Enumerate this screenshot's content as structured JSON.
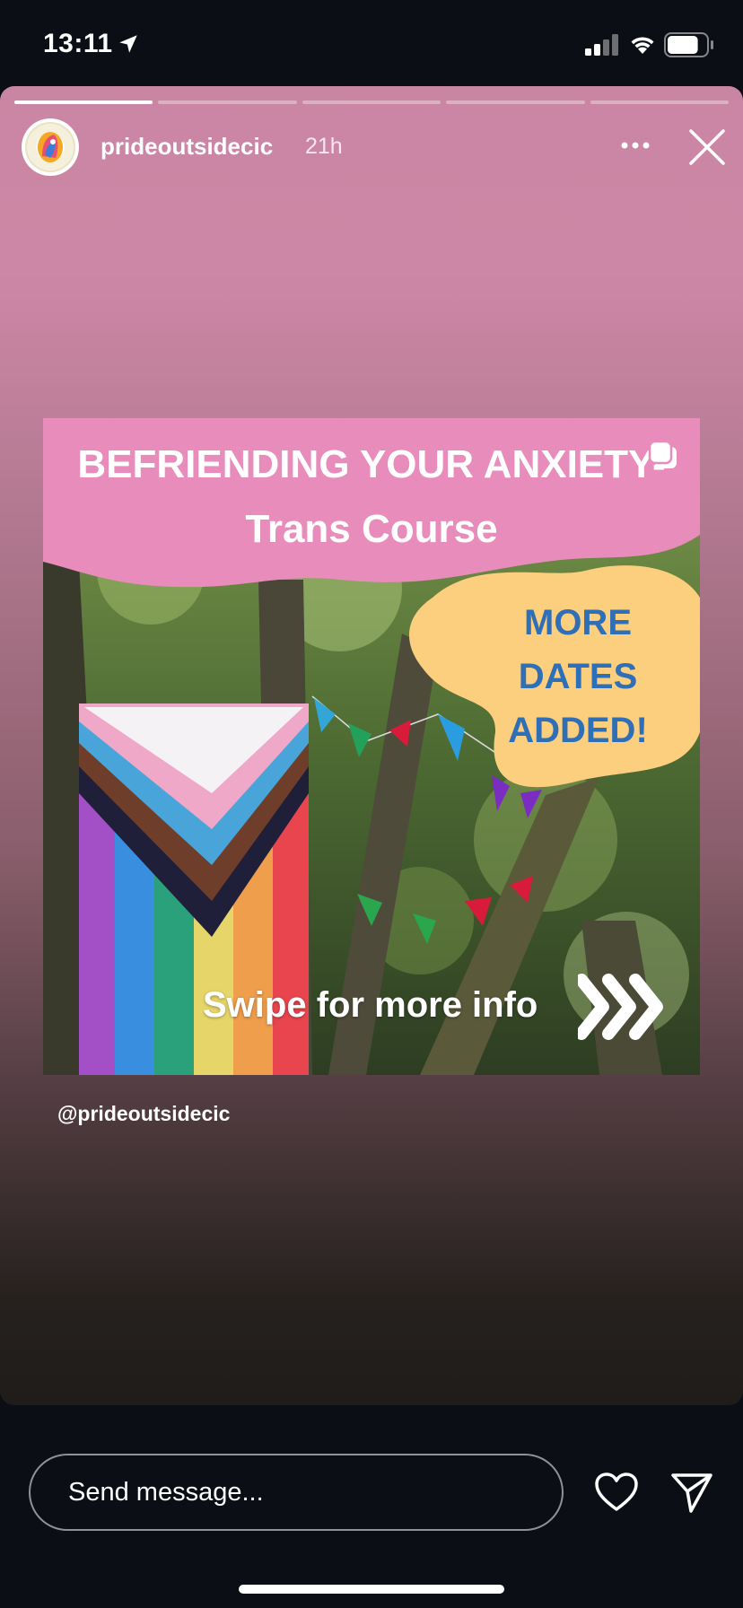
{
  "status_bar": {
    "time": "13:11",
    "icons": [
      "location-arrow-icon",
      "cellular-signal-icon",
      "wifi-icon",
      "battery-icon"
    ],
    "battery_level": 0.8,
    "signal_bars": 2
  },
  "story": {
    "segments": [
      {
        "progress": 1.0
      },
      {
        "progress": 0
      },
      {
        "progress": 0
      },
      {
        "progress": 0
      },
      {
        "progress": 0
      }
    ],
    "current_segment": 1,
    "username": "prideoutsidecic",
    "age": "21h",
    "avatar_icon": "pride-outside-wellbeing-logo",
    "more_icon": "more-horizontal-icon",
    "close_icon": "close-icon",
    "gradient_colors": [
      "#cd87a6",
      "#8a5e6c",
      "#1f1c1a"
    ]
  },
  "post": {
    "title": "BEFRIENDING YOUR ANXIETY- Trans Course",
    "dates_note": "MORE DATES ADDED!",
    "swipe_text": "Swipe for more info",
    "banner_color": "#e88cbb",
    "blob_color": "#fbcf7d",
    "dates_color": "#2f6fb7",
    "icons": [
      "carousel-icon",
      "chevrons-right-icon"
    ]
  },
  "mention": "@prideoutsidecic",
  "bottom_bar": {
    "message_placeholder": "Send message...",
    "icons": [
      "heart-icon",
      "send-icon"
    ]
  }
}
